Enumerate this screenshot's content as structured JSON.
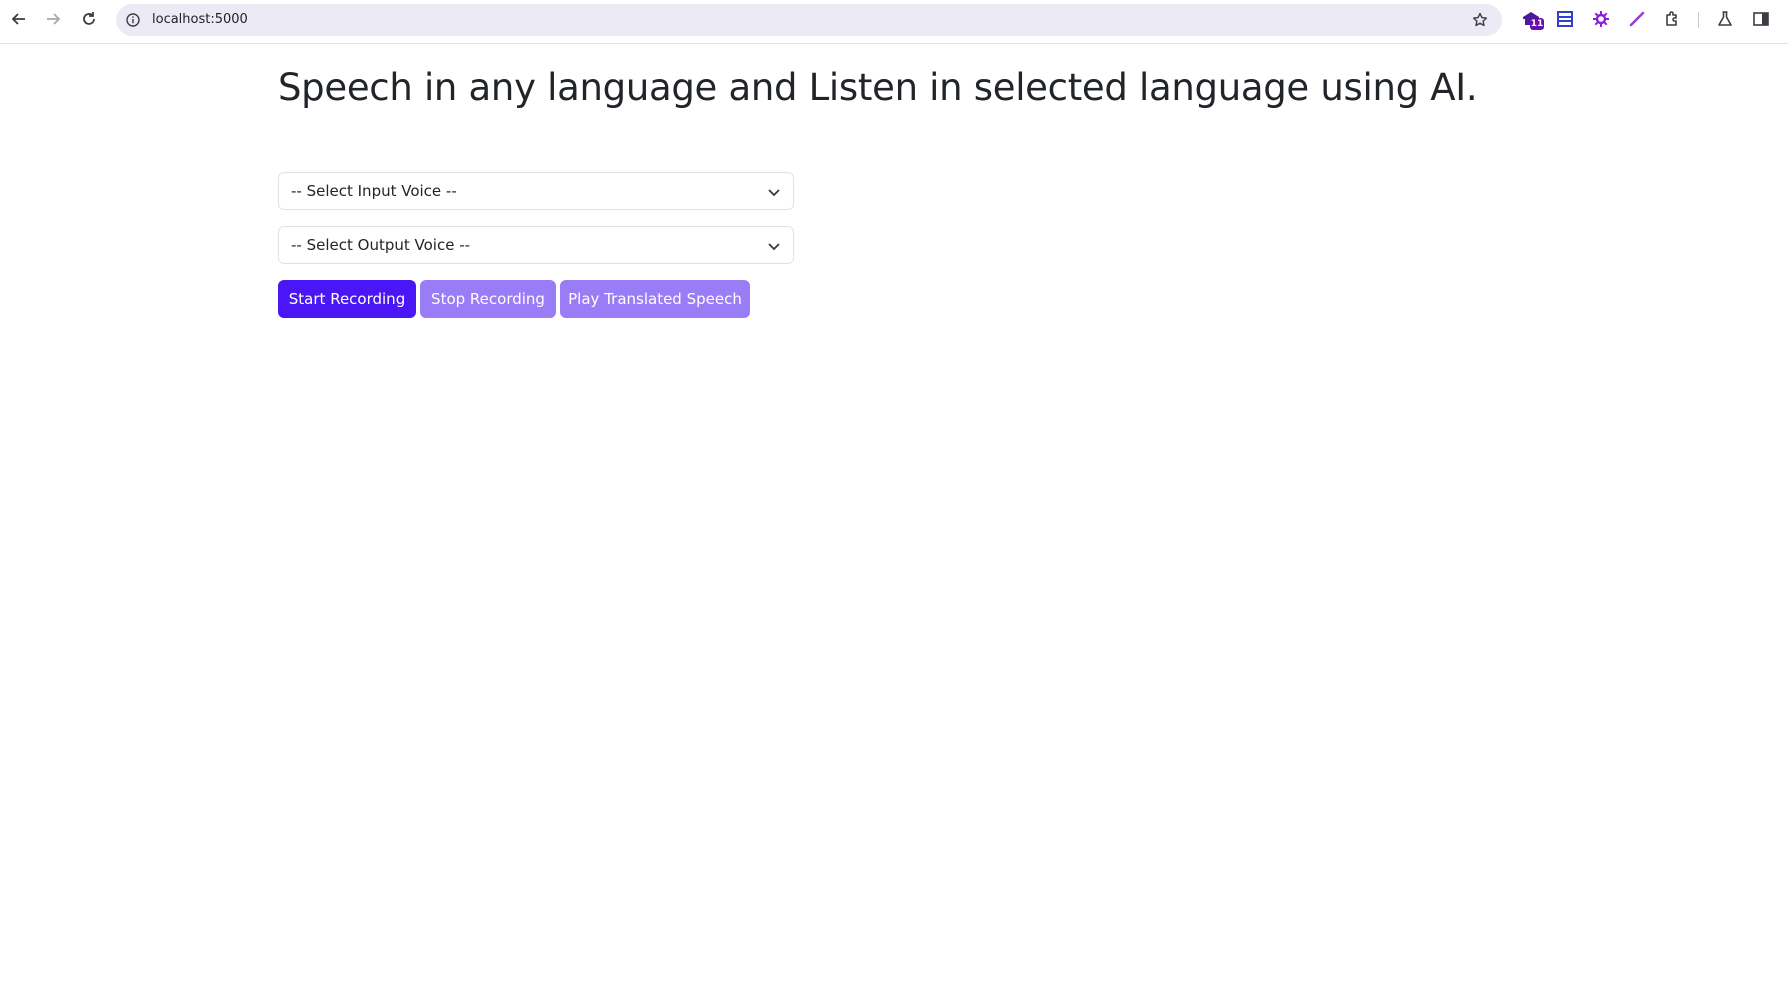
{
  "browser": {
    "url": "localhost:5000",
    "extension_badge": "11",
    "icons": [
      "back-icon",
      "forward-icon",
      "reload-icon",
      "site-info-icon",
      "bookmark-star-icon",
      "extensions-icon",
      "labs-icon",
      "side-panel-icon"
    ]
  },
  "page": {
    "title": "Speech in any language and Listen in selected language using AI.",
    "input_select": {
      "selected": "-- Select Input Voice --"
    },
    "output_select": {
      "selected": "-- Select Output Voice --"
    },
    "buttons": {
      "start": "Start Recording",
      "stop": "Stop Recording",
      "play": "Play Translated Speech"
    }
  },
  "colors": {
    "primary_button": "#4b16f5",
    "disabled_button": "#9b7cf7",
    "omnibox_bg": "#ecebf5"
  }
}
